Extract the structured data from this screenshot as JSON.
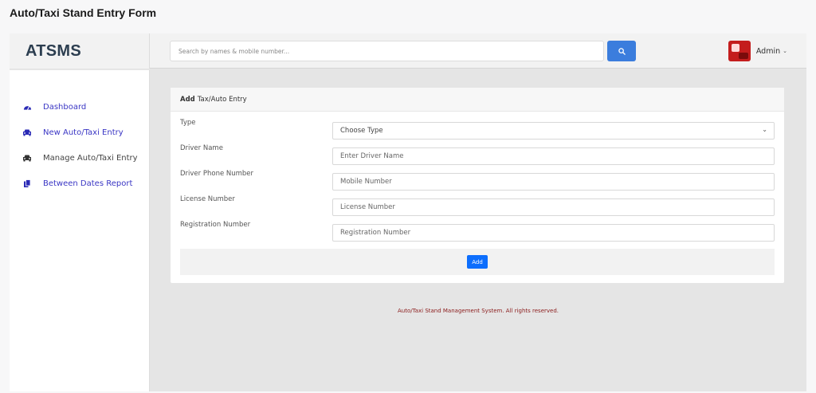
{
  "page_title": "Auto/Taxi Stand Entry Form",
  "brand": "ATSMS",
  "header": {
    "search_placeholder": "Search by names & mobile number...",
    "search_icon": "search-icon",
    "user_name": "Admin",
    "user_caret": "⌄"
  },
  "sidebar": {
    "items": [
      {
        "label": "Dashboard",
        "icon": "dashboard-icon"
      },
      {
        "label": "New Auto/Taxi Entry",
        "icon": "car-icon"
      },
      {
        "label": "Manage Auto/Taxi Entry",
        "icon": "car-icon"
      },
      {
        "label": "Between Dates Report",
        "icon": "copy-icon"
      }
    ]
  },
  "card": {
    "title_bold": "Add",
    "title_rest": "Tax/Auto Entry",
    "fields": [
      {
        "label": "Type",
        "value": "Choose Type"
      },
      {
        "label": "Driver Name",
        "placeholder": "Enter Driver Name"
      },
      {
        "label": "Driver Phone Number",
        "placeholder": "Mobile Number"
      },
      {
        "label": "License Number",
        "placeholder": "License Number"
      },
      {
        "label": "Registration Number",
        "placeholder": "Registration Number"
      }
    ],
    "submit_label": "Add"
  },
  "footer": "Auto/Taxi Stand Management System. All rights reserved.",
  "colors": {
    "accent": "#3b7ddd",
    "button": "#0d6efd",
    "sidebar_link": "#3a36c4",
    "footer_text": "#8b1c1c"
  }
}
